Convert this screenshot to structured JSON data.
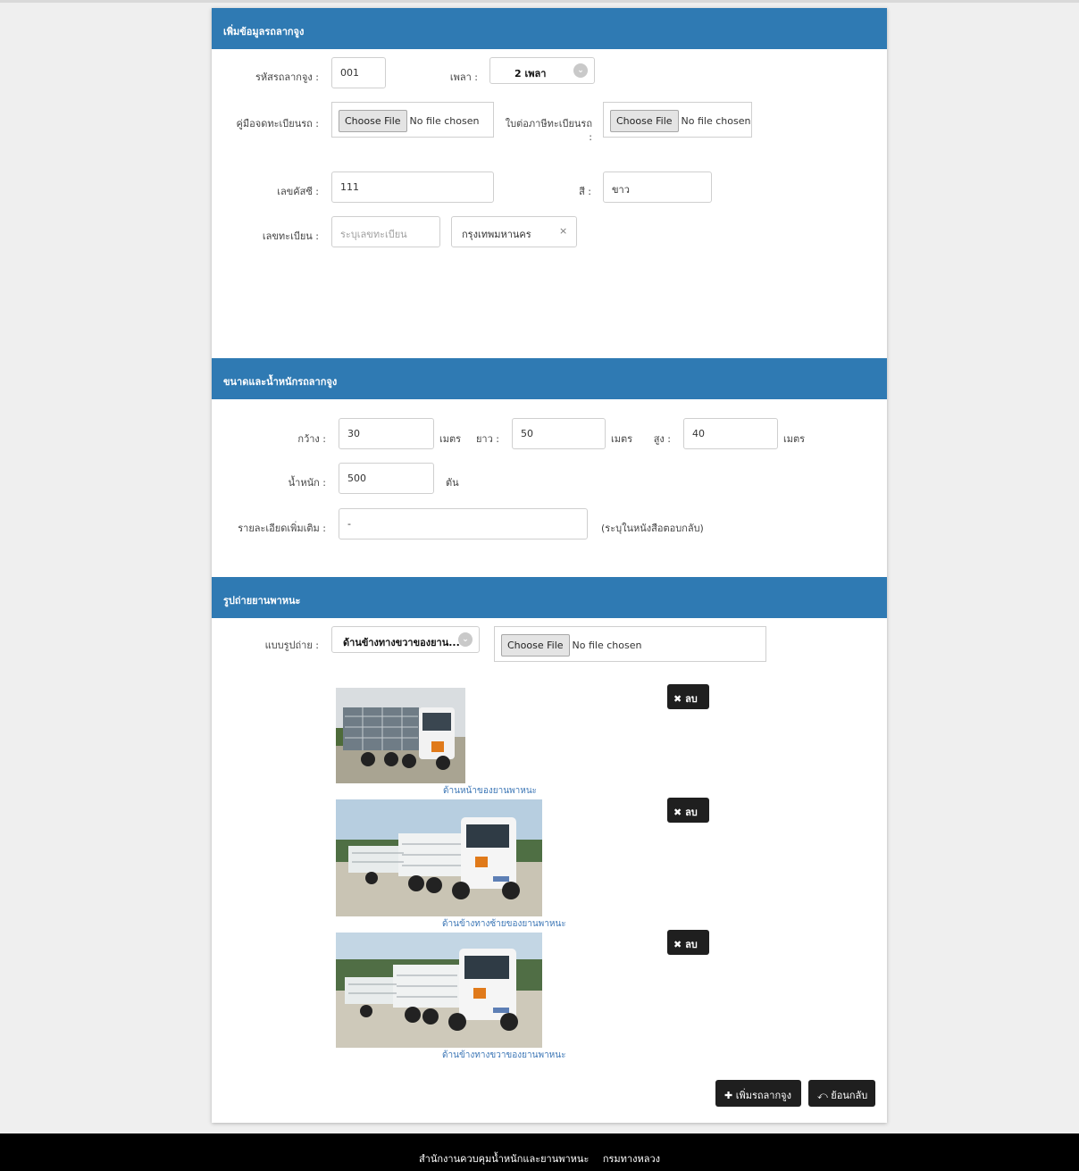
{
  "sections": {
    "truck_info": "เพิ่มข้อมูลรถลากจูง",
    "size_weight": "ขนาดและน้ำหนักรถลากจูง",
    "photos": "รูปถ่ายยานพาหนะ"
  },
  "truck_info": {
    "code_label": "รหัสรถลากจูง :",
    "code_value": "001",
    "axle_label": "เพลา :",
    "axle_value": "2 เพลา",
    "manual_label": "คู่มือจดทะเบียนรถ :",
    "tax_label": "ใบต่อภาษีทะเบียนรถ :",
    "chassis_label": "เลขคัสซี :",
    "chassis_value": "111",
    "color_label": "สี :",
    "color_value": "ขาว",
    "plate_label": "เลขทะเบียน :",
    "plate_placeholder": "ระบุเลขทะเบียน",
    "province_value": "กรุงเทพมหานคร",
    "province_clear": "×"
  },
  "file_input": {
    "button": "Choose File",
    "status": "No file chosen"
  },
  "size_weight": {
    "width_label": "กว้าง :",
    "width_value": "30",
    "length_label": "ยาว :",
    "length_value": "50",
    "height_label": "สูง :",
    "height_value": "40",
    "unit_meter": "เมตร",
    "weight_label": "น้ำหนัก :",
    "weight_value": "500",
    "unit_ton": "ตัน",
    "details_label": "รายละเอียดเพิ่มเติม :",
    "details_value": "-",
    "details_note": "(ระบุในหนังสือตอบกลับ)"
  },
  "photos": {
    "pattern_label": "แบบรูปถ่าย :",
    "pattern_value": "ด้านข้างทางขวาของยาน...",
    "delete_label": "ลบ",
    "items": [
      {
        "caption": "ด้านหน้าของยานพาหนะ"
      },
      {
        "caption": "ด้านข้างทางซ้ายของยานพาหนะ"
      },
      {
        "caption": "ด้านข้างทางขวาของยานพาหนะ"
      }
    ]
  },
  "actions": {
    "add_label": "เพิ่มรถลากจูง",
    "back_label": "ย้อนกลับ"
  },
  "footer": {
    "org": "สำนักงานควบคุมน้ำหนักและยานพาหนะ",
    "dept": "กรมทางหลวง"
  },
  "colors": {
    "header": "#2f7ab3",
    "caption": "#3d77b6",
    "button_dark": "#1f1f1f"
  }
}
